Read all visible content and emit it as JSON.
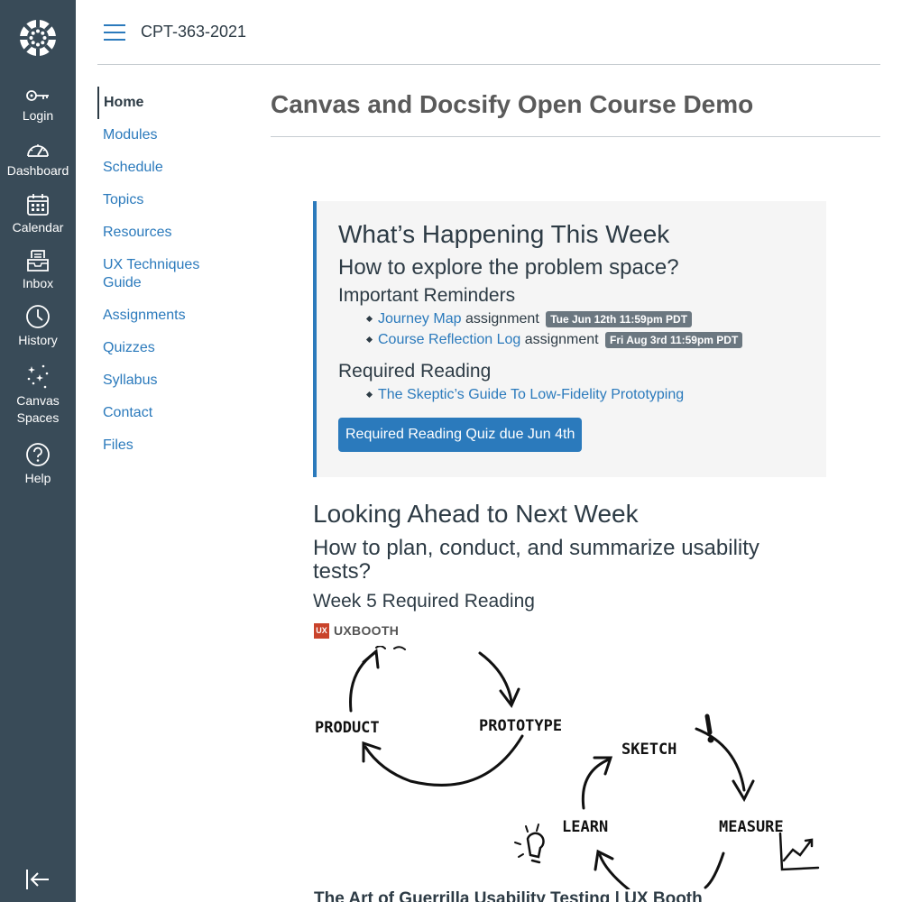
{
  "global_nav": {
    "items": [
      {
        "label": "Login",
        "icon": "key-icon"
      },
      {
        "label": "Dashboard",
        "icon": "dashboard-icon"
      },
      {
        "label": "Calendar",
        "icon": "calendar-icon"
      },
      {
        "label": "Inbox",
        "icon": "inbox-icon"
      },
      {
        "label": "History",
        "icon": "clock-icon"
      },
      {
        "label": "Canvas Spaces",
        "label_line1": "Canvas",
        "label_line2": "Spaces",
        "icon": "sparkles-icon"
      },
      {
        "label": "Help",
        "icon": "help-icon"
      }
    ],
    "colors": {
      "background": "#394b58",
      "text": "#ffffff"
    }
  },
  "header": {
    "breadcrumb": "CPT-363-2021"
  },
  "course_nav": {
    "items": [
      {
        "label": "Home",
        "active": true
      },
      {
        "label": "Modules"
      },
      {
        "label": "Schedule"
      },
      {
        "label": "Topics"
      },
      {
        "label": "Resources"
      },
      {
        "label": "UX Techniques Guide",
        "label_line1": "UX Techniques",
        "label_line2": "Guide"
      },
      {
        "label": "Assignments"
      },
      {
        "label": "Quizzes"
      },
      {
        "label": "Syllabus"
      },
      {
        "label": "Contact"
      },
      {
        "label": "Files"
      }
    ]
  },
  "page": {
    "title": "Canvas and Docsify Open Course Demo"
  },
  "this_week": {
    "heading": "What’s Happening This Week",
    "question": "How to explore the problem space?",
    "reminders_heading": "Important Reminders",
    "reminders": [
      {
        "link": "Journey Map",
        "text": "assignment",
        "badge": "Tue Jun 12th 11:59pm PDT"
      },
      {
        "link": "Course Reflection Log",
        "text": "assignment",
        "badge": "Fri Aug 3rd 11:59pm PDT"
      }
    ],
    "reading_heading": "Required Reading",
    "readings": [
      {
        "link": "The Skeptic’s Guide To Low-Fidelity Prototyping"
      }
    ],
    "quiz_button": "Required Reading Quiz due Jun 4th"
  },
  "next_week": {
    "heading": "Looking Ahead to Next Week",
    "question": "How to plan, conduct, and summarize usability tests?",
    "reading_heading": "Week 5 Required Reading",
    "site_icon_text": "UX",
    "site_name": "UXBOOTH",
    "sketch_labels": [
      "PRODUCT",
      "PROTOTYPE",
      "SKETCH",
      "MEASURE",
      "LEARN"
    ],
    "link_title": "The Art of Guerrilla Usability Testing | UX Booth"
  },
  "colors": {
    "link": "#2b7abc",
    "accent_border": "#2b7abc",
    "badge": "#6b7780",
    "button": "#2b7abc",
    "panel_bg": "#f5f5f5",
    "uxbooth_icon": "#c9432b"
  }
}
